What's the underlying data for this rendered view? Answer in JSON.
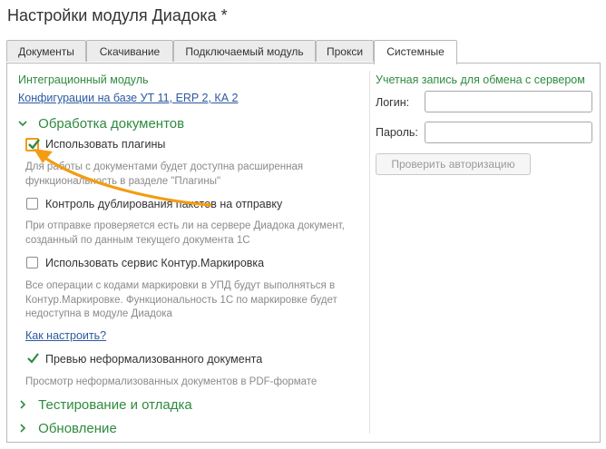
{
  "window": {
    "title": "Настройки модуля Диадока *"
  },
  "tabs": [
    {
      "label": "Документы"
    },
    {
      "label": "Скачивание"
    },
    {
      "label": "Подключаемый модуль"
    },
    {
      "label": "Прокси"
    },
    {
      "label": "Системные",
      "active": true
    }
  ],
  "left": {
    "integration_title": "Интеграционный модуль",
    "integration_link": "Конфигурации на базе УТ 11, ERP 2, КА 2",
    "doc_processing": {
      "title": "Обработка документов",
      "expanded": true,
      "options": [
        {
          "label": "Использовать плагины",
          "checked": true,
          "note_lines": [
            "Для работы с документами будет доступна расширенная",
            "функциональность в разделе \"Плагины\""
          ]
        },
        {
          "label": "Контроль дублирования пакетов на отправку",
          "checked": false,
          "note_lines": [
            "При отправке проверяется есть ли на сервере Диадока документ,",
            "созданный по данным текущего документа 1С"
          ]
        },
        {
          "label": "Использовать сервис Контур.Маркировка",
          "checked": false,
          "note_lines": [
            "Все операции с кодами маркировки в УПД будут выполняться в",
            "Контур.Маркировке. Функциональность 1С по маркировке будет",
            "недоступна в модуле Диадока"
          ]
        }
      ],
      "how_to_link": "Как настроить?",
      "preview": {
        "label": "Превью неформализованного документа",
        "checked": true,
        "note": "Просмотр неформализованных документов в PDF-формате"
      }
    },
    "testing": {
      "title": "Тестирование и отладка",
      "expanded": false
    },
    "update": {
      "title": "Обновление",
      "expanded": false
    }
  },
  "right": {
    "title": "Учетная запись для обмена с сервером",
    "login_label": "Логин:",
    "login_value": "",
    "password_label": "Пароль:",
    "password_value": "",
    "check_button": "Проверить авторизацию"
  },
  "colors": {
    "accent_green": "#2e8b3e",
    "link_blue": "#2c5aa0",
    "highlight_orange": "#f39c12"
  },
  "icons": {
    "expanded": "chevron-down-icon",
    "collapsed": "chevron-right-icon",
    "check": "checkmark-icon",
    "pointer": "arrow-icon"
  }
}
